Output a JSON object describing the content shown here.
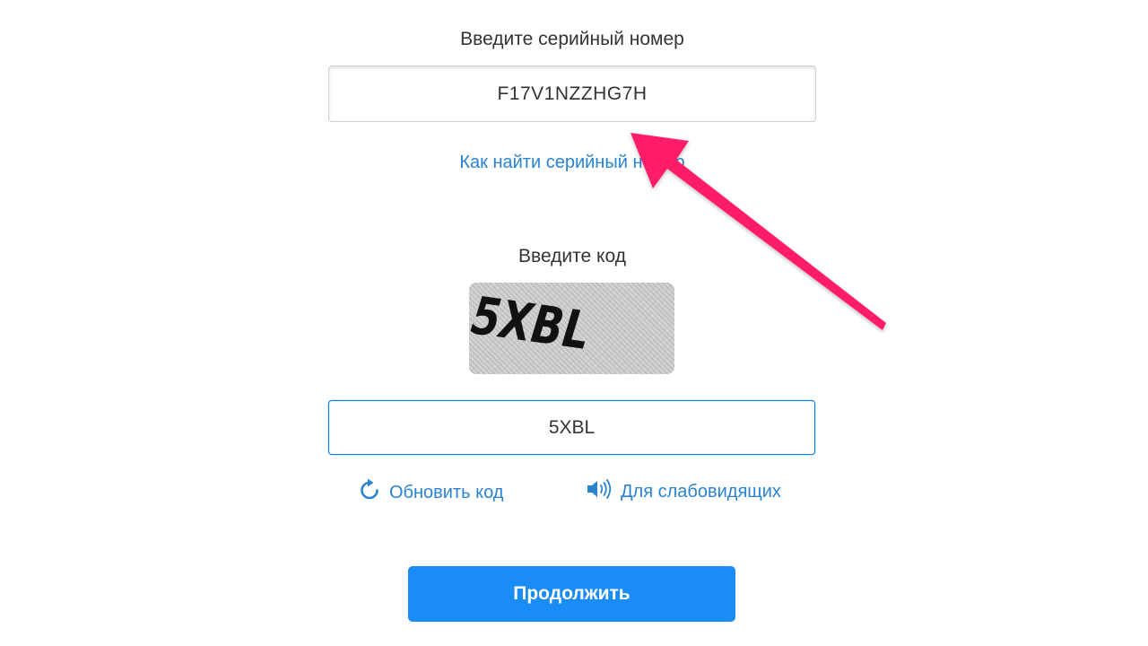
{
  "serial": {
    "label": "Введите серийный номер",
    "value": "F17V1NZZHG7H",
    "help_link": "Как найти серийный номер"
  },
  "captcha": {
    "label": "Введите код",
    "image_text": "5XBL",
    "value": "5XBL",
    "refresh_label": "Обновить код",
    "audio_label": "Для слабовидящих"
  },
  "actions": {
    "continue_label": "Продолжить"
  },
  "colors": {
    "link": "#2a82d1",
    "button": "#1a8cf5",
    "annotation_arrow": "#ff1f6a"
  },
  "icons": {
    "refresh": "refresh-icon",
    "audio": "speaker-icon",
    "annotation": "arrow-annotation"
  }
}
